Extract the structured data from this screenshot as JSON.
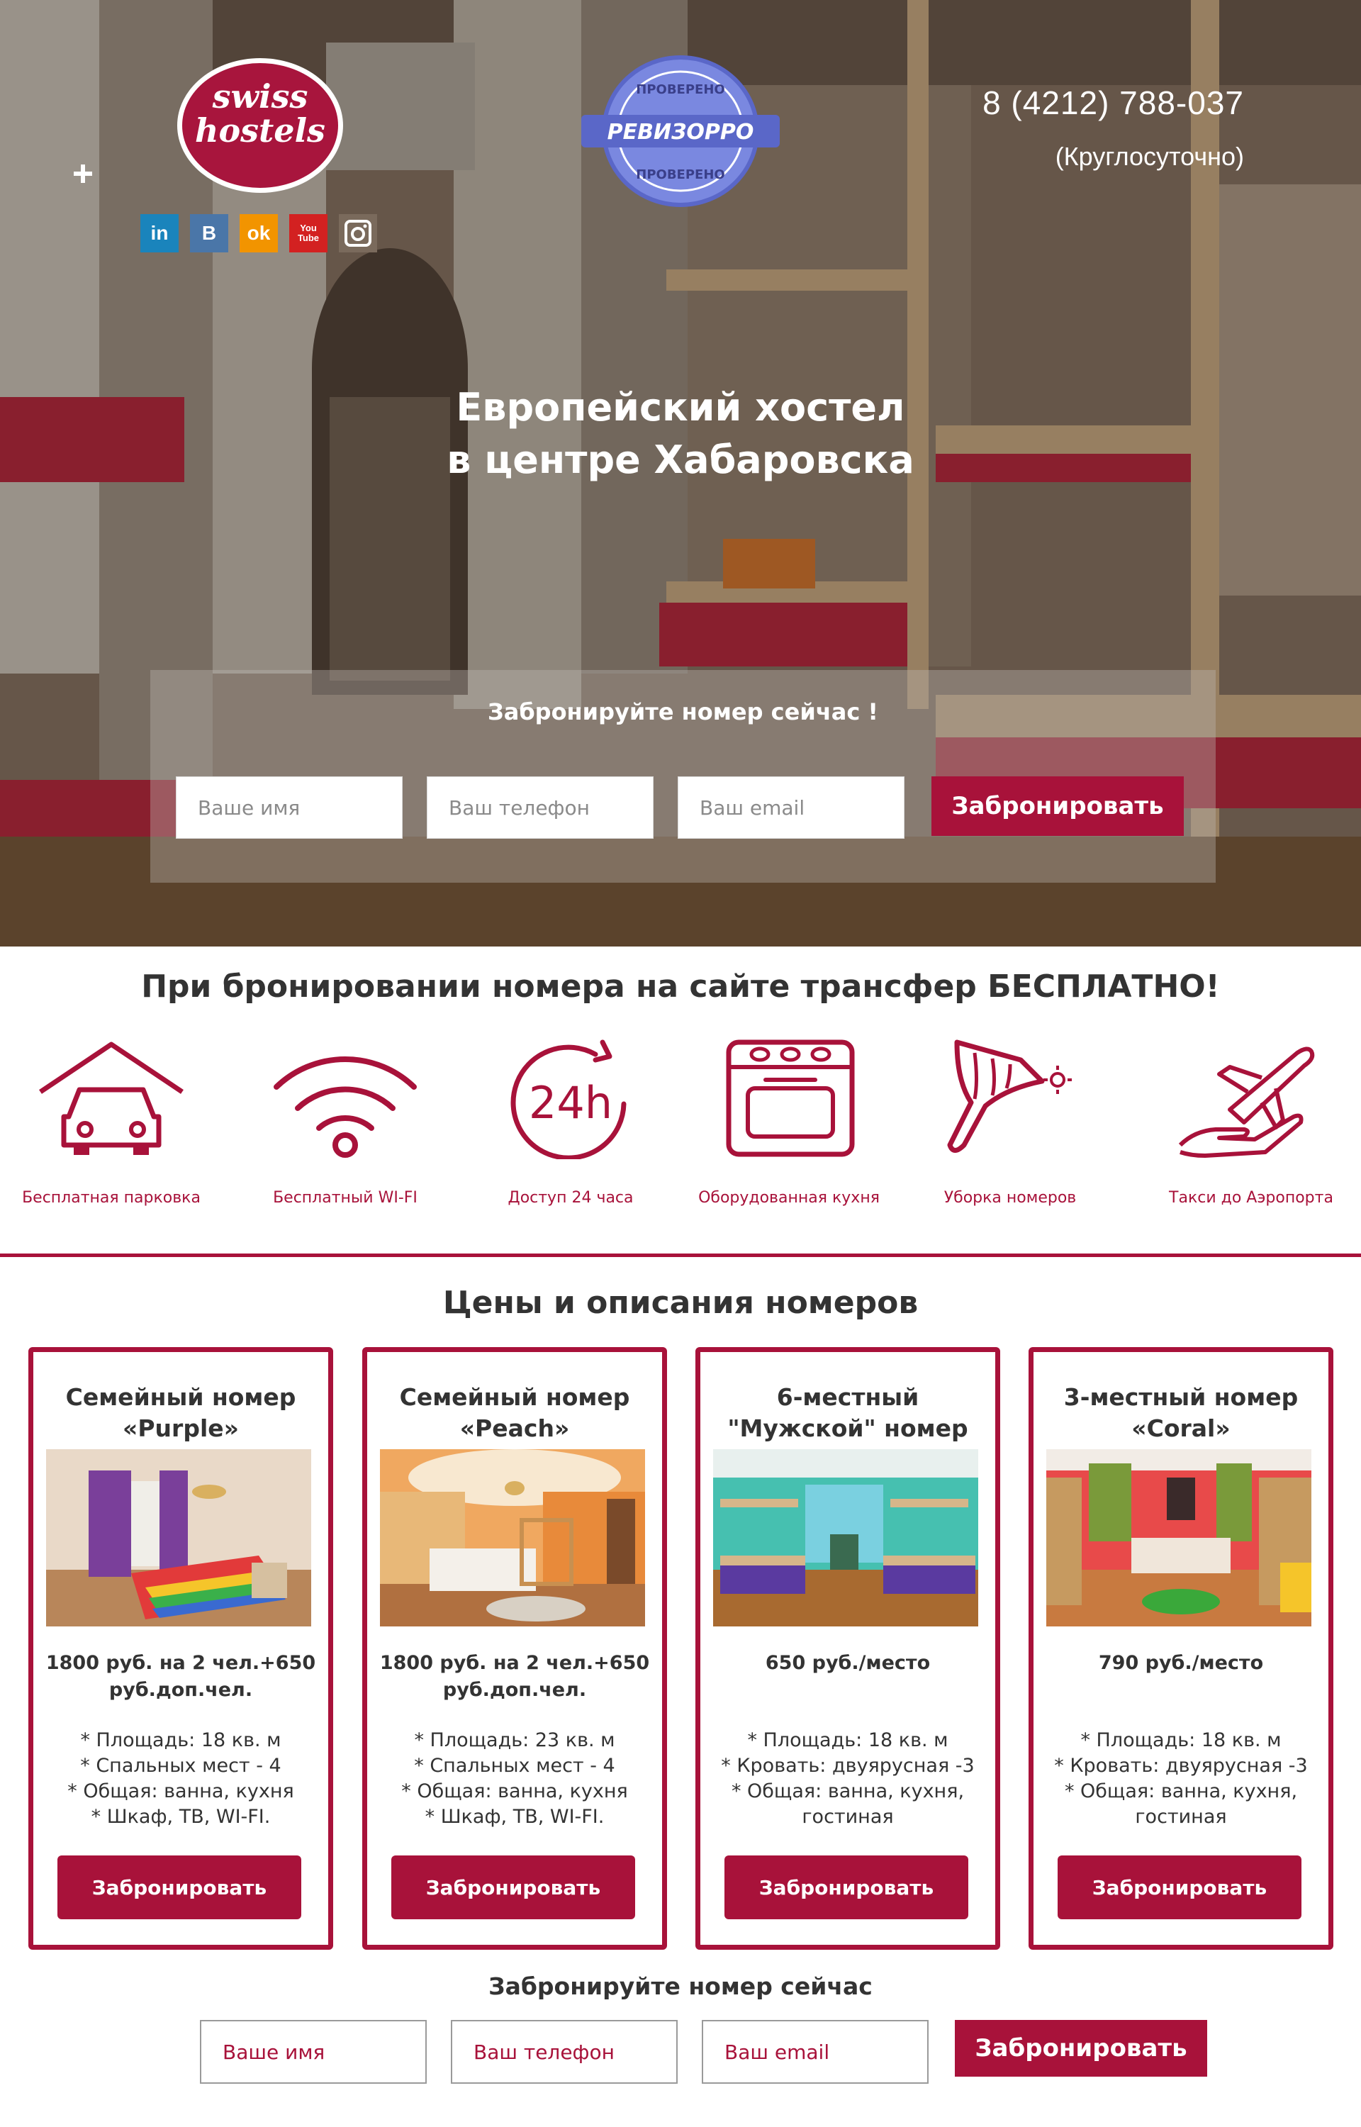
{
  "colors": {
    "accent": "#a8123a",
    "text": "#333333",
    "linkedin": "#1a84bc",
    "vk": "#4a76a8",
    "odnoklassniki": "#f29400",
    "youtube": "#d32121",
    "instagram": "#7a6a5c"
  },
  "header": {
    "logo_text": "swiss hostels",
    "badge": {
      "top_text": "ПРОВЕРЕНО",
      "name": "РЕВИЗОРРО",
      "bottom_text": "ПРОВЕРЕНО"
    },
    "socials": [
      {
        "icon": "linkedin-icon",
        "label": "in"
      },
      {
        "icon": "vk-icon",
        "label": "B"
      },
      {
        "icon": "odnoklassniki-icon",
        "label": "ok"
      },
      {
        "icon": "youtube-icon",
        "label": "You Tube"
      },
      {
        "icon": "instagram-icon",
        "label": ""
      }
    ],
    "phone": "8 (4212) 788-037",
    "phone_note": "(Круглосуточно)"
  },
  "hero": {
    "headline_line1": "Европейский хостел",
    "headline_line2": "в центре Хабаровска",
    "booking": {
      "title": "Забронируйте номер сейчас !",
      "name_placeholder": "Ваше имя",
      "phone_placeholder": "Ваш телефон",
      "email_placeholder": "Ваш email",
      "button": "Забронировать"
    }
  },
  "features": {
    "title": "При бронировании номера на сайте трансфер БЕСПЛАТНО!",
    "items": [
      {
        "icon": "parking-icon",
        "label": "Бесплатная парковка"
      },
      {
        "icon": "wifi-icon",
        "label": "Бесплатный WI-FI"
      },
      {
        "icon": "24h-icon",
        "label": "Доступ 24 часа",
        "icon_text": "24h"
      },
      {
        "icon": "stove-icon",
        "label": "Оборудованная кухня"
      },
      {
        "icon": "cleaning-icon",
        "label": "Уборка номеров"
      },
      {
        "icon": "airplane-icon",
        "label": "Такси до Аэропорта"
      }
    ]
  },
  "rooms": {
    "title": "Цены и описания номеров",
    "items": [
      {
        "title_line1": "Семейный номер",
        "title_line2": "«Purple»",
        "price_line1": "1800 руб. на 2 чел.+650",
        "price_line2": "руб.доп.чел.",
        "features": [
          "* Площадь: 18 кв. м",
          "* Спальных мест - 4",
          "* Общая: ванна, кухня",
          "* Шкаф, ТВ, WI-FI."
        ],
        "button": "Забронировать"
      },
      {
        "title_line1": "Семейный номер",
        "title_line2": "«Peach»",
        "price_line1": "1800 руб. на 2 чел.+650",
        "price_line2": "руб.доп.чел.",
        "features": [
          "* Площадь: 23 кв. м",
          "* Спальных мест - 4",
          "* Общая: ванна, кухня",
          "* Шкаф, ТВ, WI-FI."
        ],
        "button": "Забронировать"
      },
      {
        "title_line1": "6-местный",
        "title_line2": "\"Мужской\" номер",
        "price_line1": "650 руб./место",
        "price_line2": "",
        "features": [
          "* Площадь: 18 кв. м",
          "* Кровать: двуярусная -3",
          "* Общая: ванна, кухня,",
          "гостиная"
        ],
        "button": "Забронировать"
      },
      {
        "title_line1": "3-местный номер",
        "title_line2": "«Coral»",
        "price_line1": "790 руб./место",
        "price_line2": "",
        "features": [
          "* Площадь: 18 кв. м",
          "* Кровать: двуярусная -3",
          "* Общая: ванна, кухня,",
          "гостиная"
        ],
        "button": "Забронировать"
      }
    ]
  },
  "bottom_booking": {
    "title": "Забронируйте номер сейчас",
    "name_placeholder": "Ваше имя",
    "phone_placeholder": "Ваш телефон",
    "email_placeholder": "Ваш email",
    "button": "Забронировать"
  }
}
